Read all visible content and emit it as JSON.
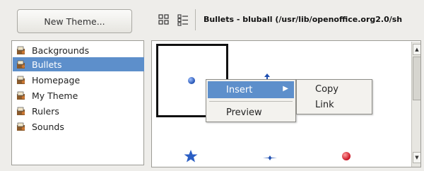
{
  "new_theme_button": "New Theme...",
  "themes": [
    {
      "label": "Backgrounds",
      "selected": false
    },
    {
      "label": "Bullets",
      "selected": true
    },
    {
      "label": "Homepage",
      "selected": false
    },
    {
      "label": "My Theme",
      "selected": false
    },
    {
      "label": "Rulers",
      "selected": false
    },
    {
      "label": "Sounds",
      "selected": false
    }
  ],
  "toolbar": {
    "icon_view": "icon-view-icon",
    "detail_view": "detail-view-icon",
    "path_title": "Bullets - bluball (/usr/lib/openoffice.org2.0/sh"
  },
  "context_menu": {
    "insert": "Insert",
    "preview": "Preview"
  },
  "submenu": {
    "copy": "Copy",
    "link": "Link"
  },
  "colors": {
    "selection": "#5d8fcb",
    "bullet_blue": "#1f4fb0",
    "bullet_red": "#d0202a"
  }
}
